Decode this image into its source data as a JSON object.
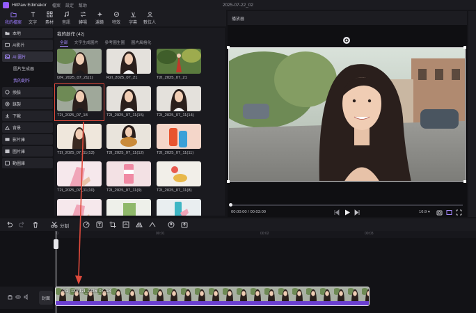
{
  "app": {
    "name": "HitPaw Edimakor",
    "document_title": "2025-07-22_02",
    "menu": [
      "檔案",
      "設定",
      "幫助"
    ]
  },
  "toolbar": {
    "items": [
      {
        "label": "我的檔案",
        "icon": "folder-icon",
        "active": true
      },
      {
        "label": "文字",
        "icon": "text-icon"
      },
      {
        "label": "素材",
        "icon": "grid-icon"
      },
      {
        "label": "音訊",
        "icon": "music-icon"
      },
      {
        "label": "轉場",
        "icon": "transition-icon"
      },
      {
        "label": "濾鏡",
        "icon": "filter-icon"
      },
      {
        "label": "特效",
        "icon": "effect-icon"
      },
      {
        "label": "字幕",
        "icon": "subtitle-icon"
      },
      {
        "label": "數位人",
        "icon": "avatar-icon"
      }
    ]
  },
  "sidebar": {
    "items": [
      {
        "label": "本地",
        "icon": "folder-icon"
      },
      {
        "label": "AI影片",
        "icon": "ai-video-icon"
      },
      {
        "label": "AI 圖片",
        "icon": "image-icon",
        "active": true
      },
      {
        "label": "圖片生成器",
        "sub": true
      },
      {
        "label": "我的創作",
        "sub": true,
        "active": true
      },
      {
        "label": "換臉",
        "icon": "face-swap-icon"
      },
      {
        "label": "錄製",
        "icon": "record-icon"
      },
      {
        "label": "下載",
        "icon": "download-icon"
      },
      {
        "label": "背景",
        "icon": "background-icon"
      },
      {
        "label": "影片庫",
        "icon": "video-library-icon"
      },
      {
        "label": "圖片庫",
        "icon": "image-library-icon"
      },
      {
        "label": "動圖庫",
        "icon": "gif-library-icon"
      }
    ]
  },
  "library": {
    "title": "我的創作 (42)",
    "tabs": [
      "全部",
      "文字生成圖片",
      "參考圖生圖",
      "圖片風格化"
    ],
    "active_tab": 0,
    "items": [
      {
        "name": "I2R_2025_07_21(1)",
        "theme": "portrait-street"
      },
      {
        "name": "R2I_2025_07_21",
        "theme": "portrait-white"
      },
      {
        "name": "T2I_2025_07_21",
        "theme": "forest-red"
      },
      {
        "name": "T2I_2025_07_18",
        "theme": "portrait-street",
        "selected": true
      },
      {
        "name": "T2I_2025_07_11(15)",
        "theme": "portrait-white"
      },
      {
        "name": "T2I_2025_07_11(14)",
        "theme": "portrait-white"
      },
      {
        "name": "T2I_2025_07_11(13)",
        "theme": "portrait-beige"
      },
      {
        "name": "T2I_2025_07_11(12)",
        "theme": "food"
      },
      {
        "name": "T2I_2025_07_11(11)",
        "theme": "colorful"
      },
      {
        "name": "T2I_2025_07_11(10)",
        "theme": "pink-hand"
      },
      {
        "name": "T2I_2025_07_11(9)",
        "theme": "pink-can"
      },
      {
        "name": "T2I_2025_07_11(8)",
        "theme": "snack"
      },
      {
        "name": "",
        "theme": "pink-hand"
      },
      {
        "name": "",
        "theme": "green"
      },
      {
        "name": "",
        "theme": "teal"
      }
    ]
  },
  "player": {
    "title": "播放器",
    "current_time": "00:00:00",
    "total_time": "00:03:00",
    "time_separator": "/",
    "aspect_ratio": "16:9",
    "progress": 0
  },
  "timeline": {
    "ruler_marks": [
      "0",
      "00:01",
      "00:02",
      "00:03"
    ],
    "tools": [
      "undo-icon",
      "redo-icon",
      "delete-icon",
      "split-icon",
      "split-label",
      "speed-icon",
      "text-icon",
      "crop-icon",
      "rotate-icon",
      "mirror-icon",
      "effect-icon",
      "avatar-icon",
      "export-icon"
    ],
    "split_label": "分割",
    "cover_label": "封面",
    "clip_label": "G1 (:00) T2I_2025_07_18"
  },
  "colors": {
    "accent": "#9d7bff",
    "selection": "#e04a3c",
    "clip_base": "#6b3fd1"
  }
}
